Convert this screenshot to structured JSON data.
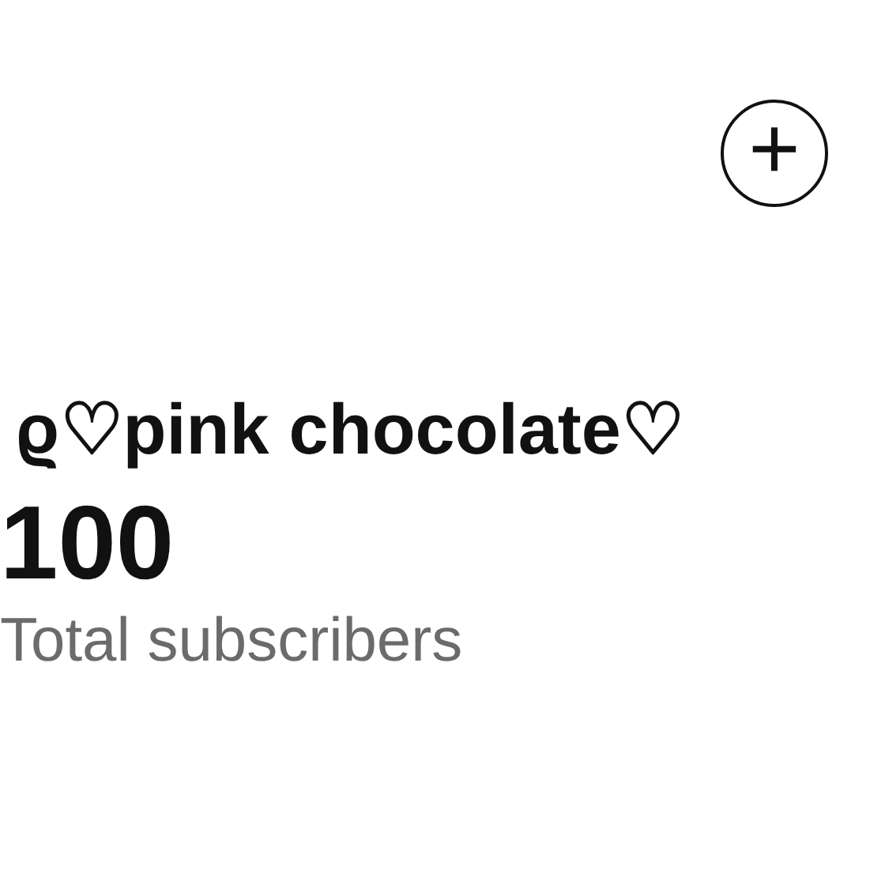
{
  "add_button": {
    "symbol": "+"
  },
  "channel_name": "ϱ♡pink chocolate♡",
  "subscriber_count": "100",
  "subscriber_label": "Total subscribers"
}
